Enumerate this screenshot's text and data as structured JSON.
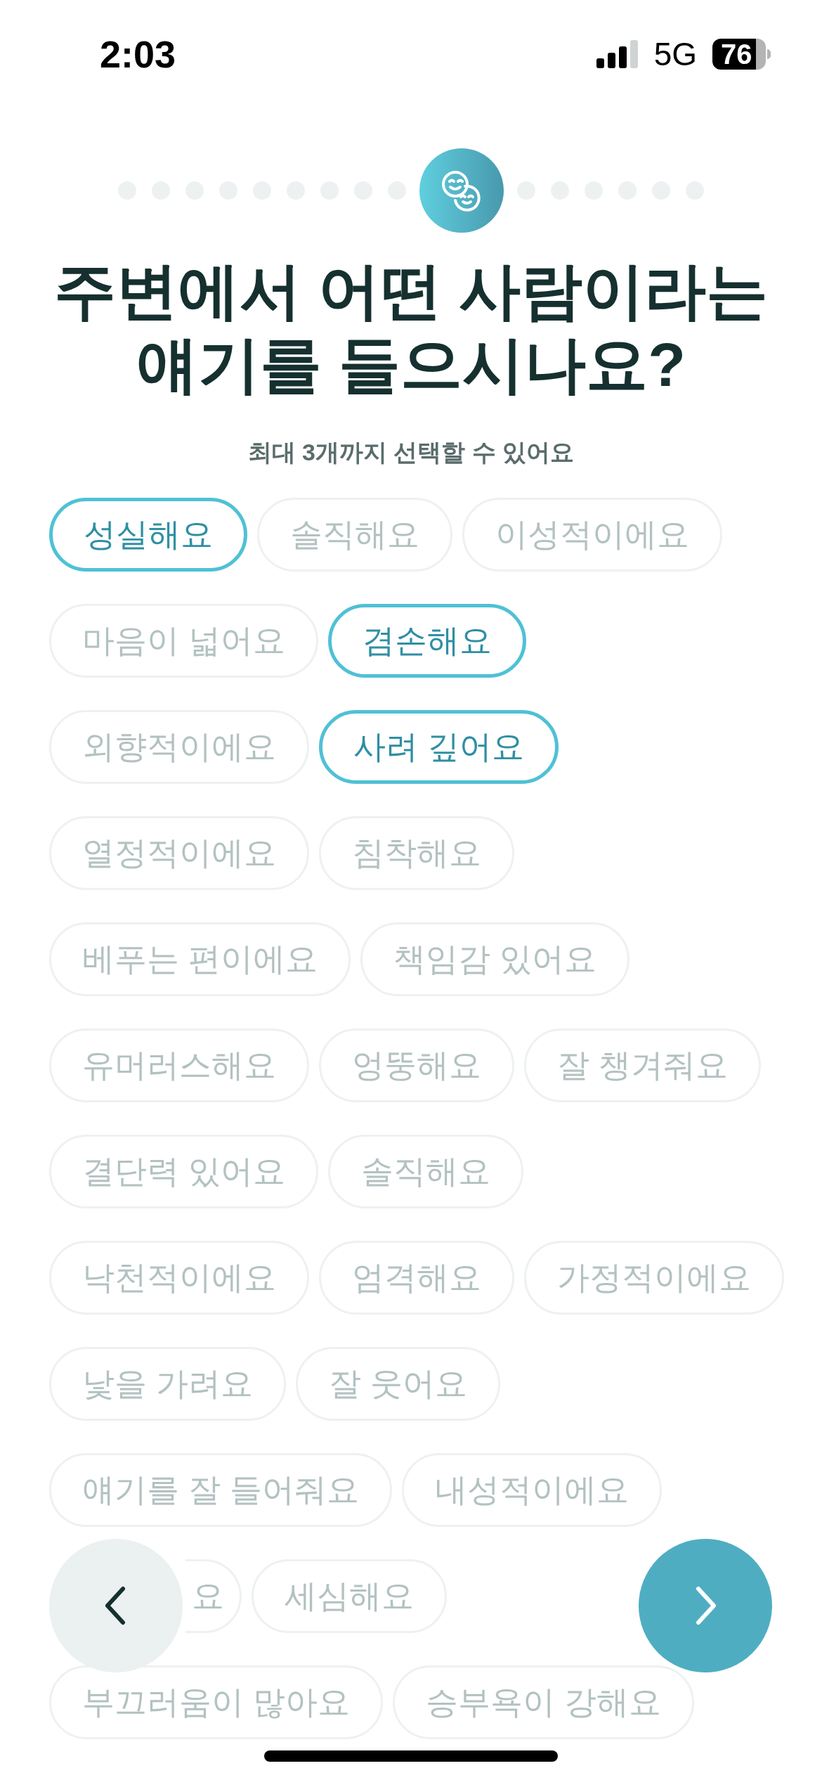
{
  "status_bar": {
    "time": "2:03",
    "network": "5G",
    "battery": "76"
  },
  "progress": {
    "steps": [
      {
        "selected": false
      },
      {
        "selected": false
      },
      {
        "selected": false
      },
      {
        "selected": false
      },
      {
        "selected": false
      },
      {
        "selected": false
      },
      {
        "selected": false
      },
      {
        "selected": false
      },
      {
        "selected": false
      },
      {
        "selected": true
      },
      {
        "selected": false
      },
      {
        "selected": false
      },
      {
        "selected": false
      },
      {
        "selected": false
      },
      {
        "selected": false
      },
      {
        "selected": false
      }
    ]
  },
  "title_lines": [
    "주변에서 어떤 사람이라는",
    "얘기를 들으시나요?"
  ],
  "subtitle": "최대 3개까지 선택할 수 있어요",
  "chip_rows": [
    [
      {
        "label": "성실해요",
        "selected": true,
        "kind": "full"
      },
      {
        "label": "솔직해요",
        "selected": false,
        "kind": "full"
      },
      {
        "label": "이성적이에요",
        "selected": false,
        "kind": "full"
      }
    ],
    [
      {
        "label": "마음이 넓어요",
        "selected": false,
        "kind": "full"
      },
      {
        "label": "겸손해요",
        "selected": true,
        "kind": "full"
      }
    ],
    [
      {
        "label": "외향적이에요",
        "selected": false,
        "kind": "full"
      },
      {
        "label": "사려 깊어요",
        "selected": true,
        "kind": "full"
      }
    ],
    [
      {
        "label": "열정적이에요",
        "selected": false,
        "kind": "full"
      },
      {
        "label": "침착해요",
        "selected": false,
        "kind": "full"
      }
    ],
    [
      {
        "label": "베푸는 편이에요",
        "selected": false,
        "kind": "full"
      },
      {
        "label": "책임감 있어요",
        "selected": false,
        "kind": "full"
      }
    ],
    [
      {
        "label": "유머러스해요",
        "selected": false,
        "kind": "full"
      },
      {
        "label": "엉뚱해요",
        "selected": false,
        "kind": "full"
      },
      {
        "label": "잘 챙겨줘요",
        "selected": false,
        "kind": "full"
      }
    ],
    [
      {
        "label": "결단력 있어요",
        "selected": false,
        "kind": "full"
      },
      {
        "label": "솔직해요",
        "selected": false,
        "kind": "full"
      }
    ],
    [
      {
        "label": "낙천적이에요",
        "selected": false,
        "kind": "full"
      },
      {
        "label": "엄격해요",
        "selected": false,
        "kind": "full"
      },
      {
        "label": "가정적이에요",
        "selected": false,
        "kind": "full"
      }
    ],
    [
      {
        "label": "낯을 가려요",
        "selected": false,
        "kind": "full"
      },
      {
        "label": "잘 웃어요",
        "selected": false,
        "kind": "full"
      }
    ],
    [
      {
        "label": "얘기를 잘 들어줘요",
        "selected": false,
        "kind": "full"
      },
      {
        "label": "내성적이에요",
        "selected": false,
        "kind": "full"
      }
    ],
    [
      {
        "label": "요",
        "selected": false,
        "kind": "partial"
      },
      {
        "label": "세심해요",
        "selected": false,
        "kind": "full"
      }
    ],
    [
      {
        "label": "부끄러움이 많아요",
        "selected": false,
        "kind": "full"
      },
      {
        "label": "승부욕이 강해요",
        "selected": false,
        "kind": "full"
      }
    ]
  ]
}
